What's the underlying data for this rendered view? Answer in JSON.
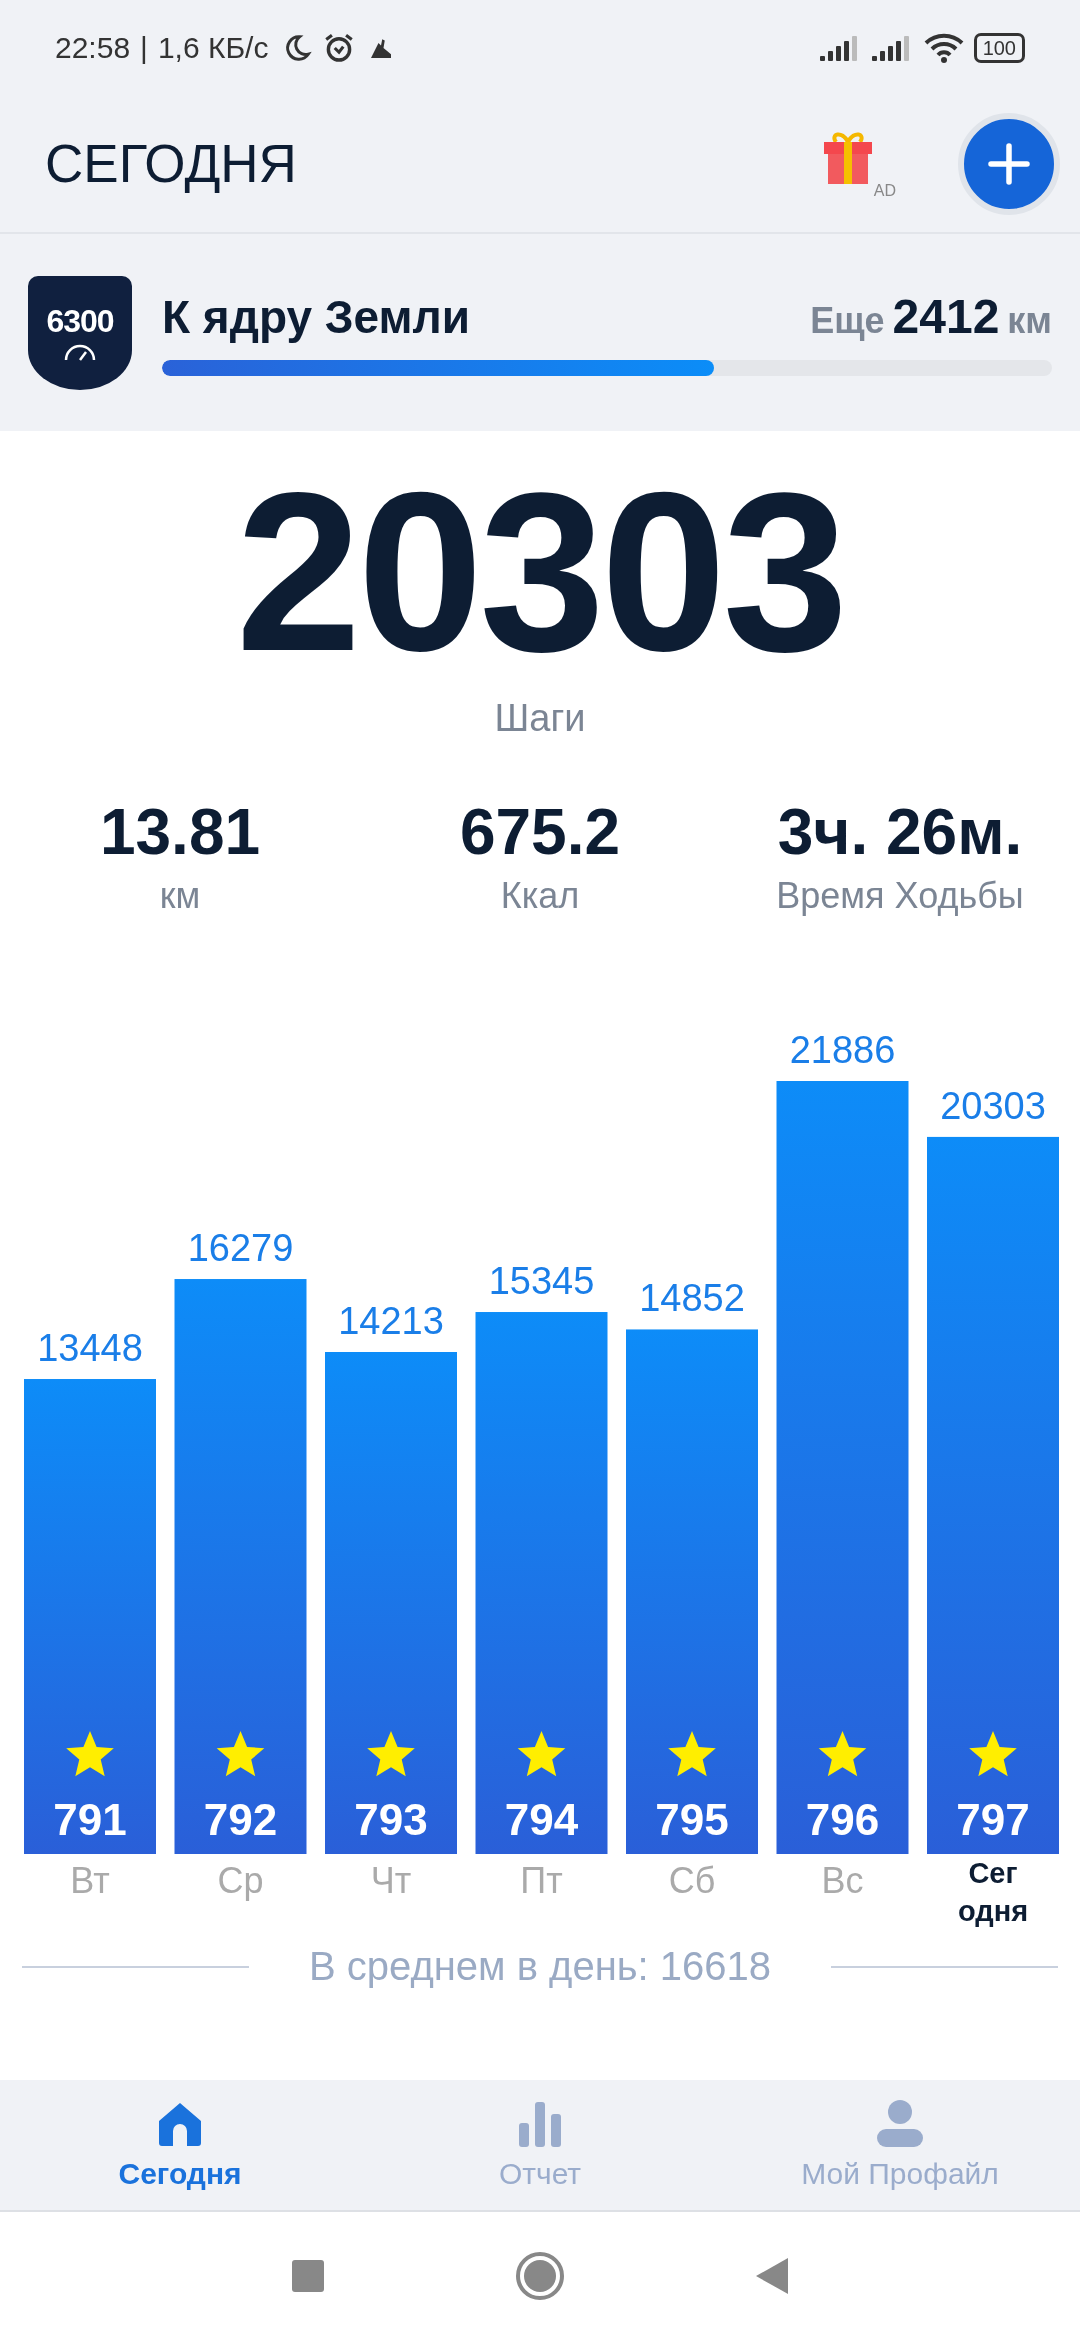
{
  "status_bar": {
    "time": "22:58",
    "separator": "|",
    "speed": "1,6 КБ/с",
    "battery": "100"
  },
  "header": {
    "title": "СЕГОДНЯ",
    "gift_badge": "AD"
  },
  "goal": {
    "badge": "6300",
    "title": "К ядру Земли",
    "remaining_label": "Еще",
    "remaining_value": "2412",
    "remaining_unit": "км",
    "level": 0.62
  },
  "steps": {
    "value": "20303",
    "label": "Шаги"
  },
  "stats": [
    {
      "value": "13.81",
      "label": "км"
    },
    {
      "value": "675.2",
      "label": "Ккал"
    },
    {
      "value": "3ч. 26м.",
      "label": "Время Ходьбы"
    }
  ],
  "chart": {
    "chart_data": {
      "type": "bar",
      "categories": [
        "Вт",
        "Ср",
        "Чт",
        "Пт",
        "Сб",
        "Вс",
        "Сег одня"
      ],
      "series": [
        {
          "color": "#1a7ee8",
          "values": [
            13448,
            16279,
            14213,
            15345,
            14852,
            21886,
            20303
          ]
        }
      ],
      "ylim": [
        0,
        21886
      ],
      "data_labels": true
    },
    "bars": [
      {
        "badge": "791",
        "current": false
      },
      {
        "badge": "792",
        "current": false
      },
      {
        "badge": "793",
        "current": false
      },
      {
        "badge": "794",
        "current": false
      },
      {
        "badge": "795",
        "current": false
      },
      {
        "badge": "796",
        "current": false
      },
      {
        "badge": "797",
        "current": true
      }
    ],
    "average": "В среднем в день: 16618"
  },
  "tabs": [
    {
      "label": "Сегодня",
      "selected": true
    },
    {
      "label": "Отчет",
      "selected": false
    },
    {
      "label": "Мой Профайл",
      "selected": false
    }
  ]
}
